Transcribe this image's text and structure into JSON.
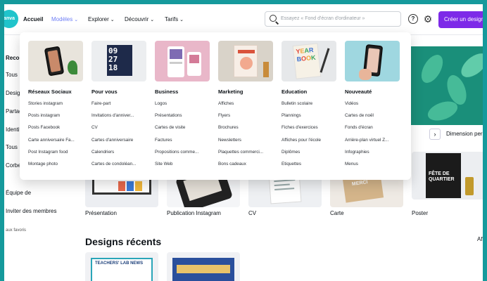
{
  "topnav": {
    "logo": "Canva",
    "items": [
      {
        "label": "Accueil",
        "chevron": false
      },
      {
        "label": "Modèles",
        "chevron": true
      },
      {
        "label": "Explorer",
        "chevron": true
      },
      {
        "label": "Découvrir",
        "chevron": true
      },
      {
        "label": "Tarifs",
        "chevron": true
      }
    ],
    "search_placeholder": "Essayez « Fond d'écran d'ordinateur »",
    "help": "?",
    "create_button": "Créer un design"
  },
  "sidebar": {
    "items": [
      "Recommandé",
      "Tous",
      "Designs",
      "Partagés",
      "Identité",
      "Tous",
      "Corbeille"
    ],
    "team": "Équipe de",
    "invite": "Inviter des membres",
    "favorites": "aux favoris"
  },
  "main": {
    "filters": [
      "o",
      "Dimension pers"
    ],
    "templates": [
      "Présentation",
      "Publication Instagram",
      "CV",
      "Carte",
      "Poster"
    ],
    "poster_text": "FÊTE DE QUARTIER",
    "card_text": "MERCI",
    "recent_title": "Designs récents",
    "recent_card_text": "TEACHERS' LAB NEWS",
    "right_edge": "Af"
  },
  "dropdown": {
    "columns": [
      {
        "title": "Réseaux Sociaux",
        "links": [
          "Stories instagram",
          "Posts instagram",
          "Posts Facebook",
          "Carte anniversaire Fa...",
          "Post Instagram food",
          "Montage photo"
        ]
      },
      {
        "title": "Pour vous",
        "links": [
          "Faire-part",
          "Invitations d'anniver...",
          "CV",
          "Cartes d'anniversaire",
          "Calendriers",
          "Cartes de condoléan..."
        ]
      },
      {
        "title": "Business",
        "links": [
          "Logos",
          "Présentations",
          "Cartes de visite",
          "Factures",
          "Propositions comme...",
          "Site Web"
        ]
      },
      {
        "title": "Marketing",
        "links": [
          "Affiches",
          "Flyers",
          "Brochures",
          "Newsletters",
          "Plaquettes commerci...",
          "Bons cadeaux"
        ]
      },
      {
        "title": "Education",
        "links": [
          "Bulletin scolaire",
          "Plannings",
          "Fiches d'exercices",
          "Affiches pour l'école",
          "Diplômes",
          "Etiquettes"
        ]
      },
      {
        "title": "Nouveauté",
        "links": [
          "Vidéos",
          "Cartes de noël",
          "Fonds d'écran",
          "Arrière-plan virtuel Z...",
          "Infographies",
          "Menus"
        ]
      }
    ],
    "calendar_numbers": [
      "09",
      "27",
      "18"
    ],
    "yearbook_letters": [
      "Y",
      "E",
      "A",
      "R",
      "B",
      "O",
      "O",
      "K"
    ]
  },
  "colors": {
    "frame": "#159a9c",
    "accent": "#7d2ae8",
    "hover": "#6c7cf5"
  }
}
